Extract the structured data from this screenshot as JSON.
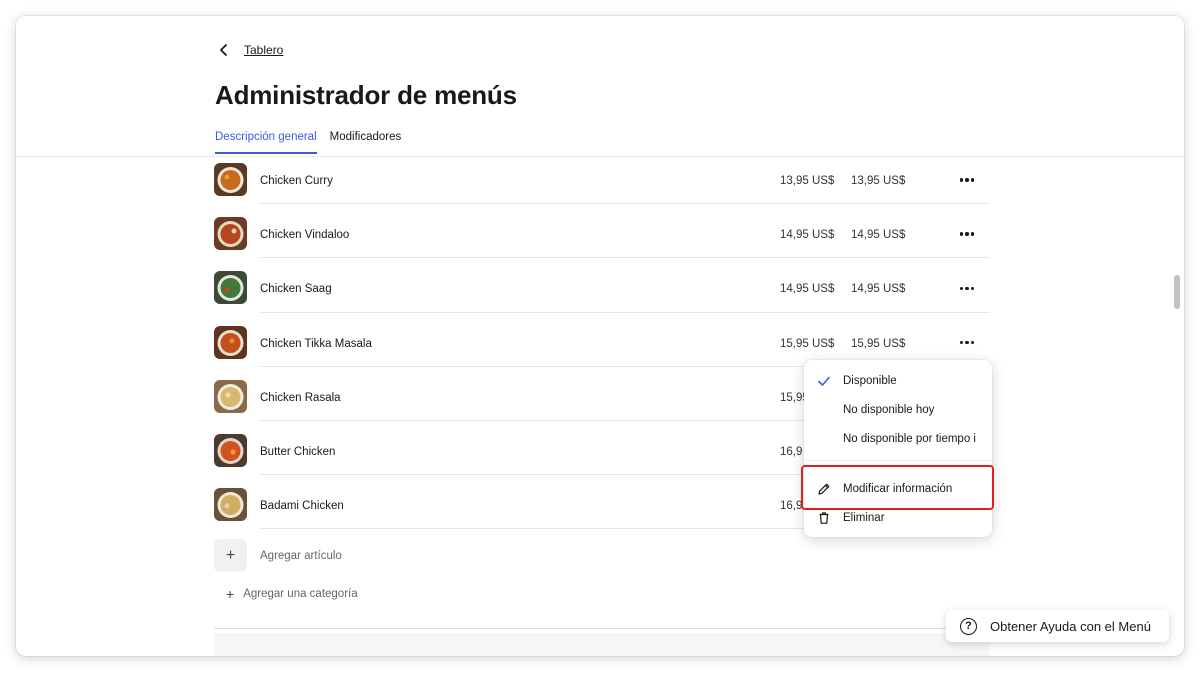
{
  "header": {
    "back_label": "Tablero",
    "title": "Administrador de menús",
    "tabs": [
      {
        "label": "Descripción general",
        "active": true
      },
      {
        "label": "Modificadores",
        "active": false
      }
    ]
  },
  "items": [
    {
      "name": "Chicken Curry",
      "price1": "13,95 US$",
      "price2": "13,95 US$",
      "thumb_color": "#c96a1c"
    },
    {
      "name": "Chicken Vindaloo",
      "price1": "14,95 US$",
      "price2": "14,95 US$",
      "thumb_color": "#b4471f"
    },
    {
      "name": "Chicken Saag",
      "price1": "14,95 US$",
      "price2": "14,95 US$",
      "thumb_color": "#3f7a3a"
    },
    {
      "name": "Chicken Tikka Masala",
      "price1": "15,95 US$",
      "price2": "15,95 US$",
      "thumb_color": "#c4501c"
    },
    {
      "name": "Chicken Rasala",
      "price1": "15,95",
      "price2": "",
      "thumb_color": "#d8b870"
    },
    {
      "name": "Butter Chicken",
      "price1": "16,9",
      "price2": "",
      "thumb_color": "#d0541f"
    },
    {
      "name": "Badami Chicken",
      "price1": "16,9",
      "price2": "",
      "thumb_color": "#cfae64"
    }
  ],
  "add_item_label": "Agregar artículo",
  "add_category_label": "Agregar una categoría",
  "context_menu": {
    "items": [
      {
        "label": "Disponible",
        "icon": "check-icon",
        "selected": true
      },
      {
        "label": "No disponible hoy",
        "icon": "",
        "selected": false
      },
      {
        "label": "No disponible por tiempo i",
        "icon": "",
        "selected": false
      },
      {
        "label": "Modificar información",
        "icon": "pencil-icon",
        "selected": false
      },
      {
        "label": "Eliminar",
        "icon": "trash-icon",
        "selected": false
      }
    ]
  },
  "help_button_label": "Obtener Ayuda con el Menú",
  "colors": {
    "accent": "#3b5bdb",
    "highlight": "#e02020"
  }
}
